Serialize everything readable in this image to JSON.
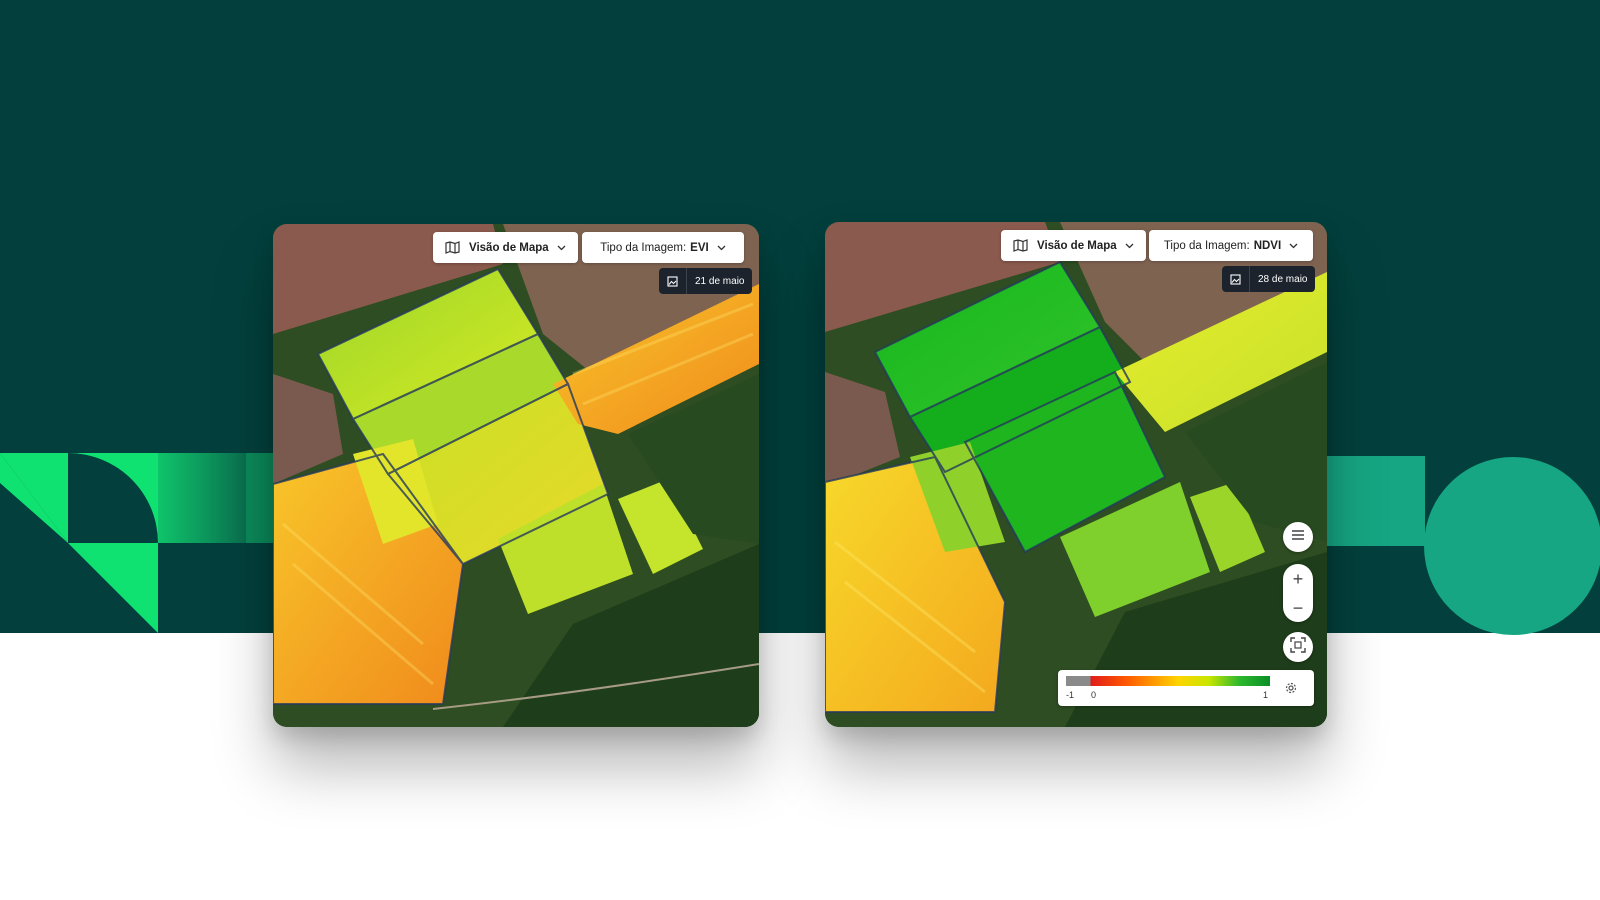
{
  "colors": {
    "background_dark": "#03403d",
    "accent_green": "#10e272",
    "accent_teal": "#16a683",
    "badge_dark": "#1c232c"
  },
  "left_panel": {
    "view_button_label": "Visão de Mapa",
    "image_type_prefix": "Tipo da Imagem:",
    "image_type_value": "EVI",
    "date": "21 de maio",
    "view_button_icon": "map-icon",
    "date_icon": "image-icon"
  },
  "right_panel": {
    "view_button_label": "Visão de Mapa",
    "image_type_prefix": "Tipo da Imagem:",
    "image_type_value": "NDVI",
    "date": "28 de maio",
    "view_button_icon": "map-icon",
    "date_icon": "image-icon",
    "controls": {
      "layers_icon": "menu-icon",
      "zoom_in_label": "+",
      "zoom_out_label": "−",
      "fit_icon": "fit-bounds-icon"
    },
    "legend": {
      "min_label": "-1",
      "mid_label": "0",
      "max_label": "1",
      "settings_icon": "gear-icon"
    }
  }
}
